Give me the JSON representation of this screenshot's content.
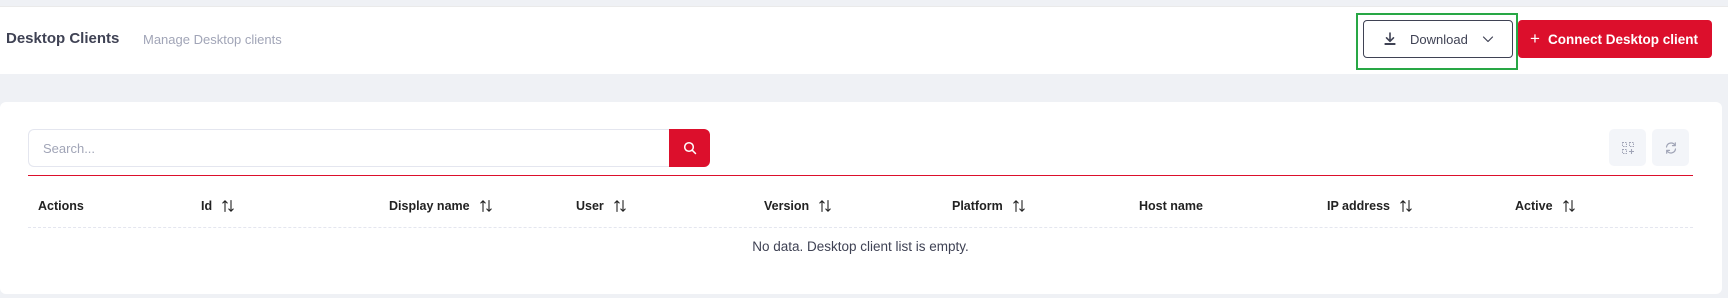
{
  "header": {
    "title": "Desktop Clients",
    "subtitle": "Manage Desktop clients",
    "download_label": "Download",
    "connect_label": "Connect Desktop client",
    "connect_icon": "+"
  },
  "search": {
    "placeholder": "Search..."
  },
  "table": {
    "columns": [
      {
        "label": "Actions",
        "sortable": false
      },
      {
        "label": "Id",
        "sortable": true
      },
      {
        "label": "Display name",
        "sortable": true
      },
      {
        "label": "User",
        "sortable": true
      },
      {
        "label": "Version",
        "sortable": true
      },
      {
        "label": "Platform",
        "sortable": true
      },
      {
        "label": "Host name",
        "sortable": false
      },
      {
        "label": "IP address",
        "sortable": true
      },
      {
        "label": "Active",
        "sortable": true
      }
    ],
    "empty_message": "No data. Desktop client list is empty."
  },
  "colors": {
    "accent": "#dc0f2c",
    "highlight": "#28a745",
    "text": "#3f4254",
    "muted": "#a1a5b7"
  },
  "icons": [
    "download-icon",
    "chevron-down-icon",
    "search-icon",
    "columns-icon",
    "refresh-icon",
    "sort-icon"
  ]
}
